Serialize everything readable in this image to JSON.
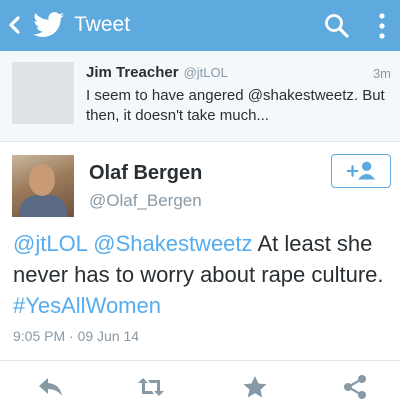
{
  "topbar": {
    "title": "Tweet",
    "background": "#5ea9dd",
    "icons": [
      "back-chevron-icon",
      "twitter-bird-icon",
      "search-icon",
      "overflow-menu-icon"
    ]
  },
  "context_tweet": {
    "name": "Jim Treacher",
    "handle": "@jtLOL",
    "time": "3m",
    "text": "I seem to have angered @shakestweetz. But then, it doesn't take much..."
  },
  "main_tweet": {
    "name": "Olaf Bergen",
    "handle": "@Olaf_Bergen",
    "text_parts": {
      "mention1": "@jtLOL",
      "mention2": "@Shakestweetz",
      "body": "At least she never has to worry about rape culture.",
      "hashtag": "#YesAllWomen"
    },
    "timestamp": "9:05 PM · 09 Jun 14",
    "follow_icon": "follow-user-icon"
  },
  "actions": [
    "reply-icon",
    "retweet-icon",
    "favorite-star-icon",
    "share-icon"
  ],
  "colors": {
    "accent": "#55acee",
    "text": "#292f33",
    "muted": "#8899a6"
  }
}
